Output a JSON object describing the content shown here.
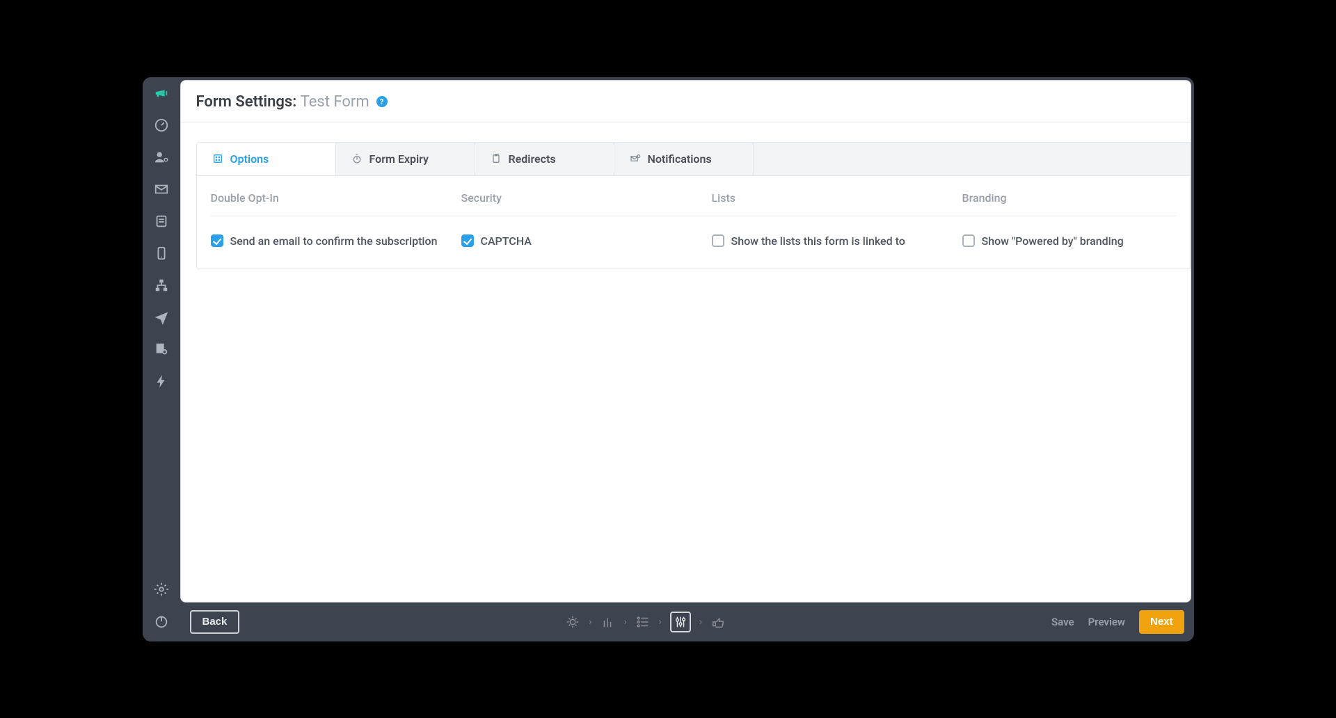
{
  "header": {
    "title_prefix": "Form Settings:",
    "form_name": "Test Form",
    "help_symbol": "?"
  },
  "tabs": [
    {
      "label": "Options",
      "active": true
    },
    {
      "label": "Form Expiry",
      "active": false
    },
    {
      "label": "Redirects",
      "active": false
    },
    {
      "label": "Notifications",
      "active": false
    }
  ],
  "columns": {
    "c1": "Double Opt-In",
    "c2": "Security",
    "c3": "Lists",
    "c4": "Branding"
  },
  "options": {
    "double_opt_in": {
      "label": "Send an email to confirm the subscription",
      "checked": true
    },
    "security": {
      "label": "CAPTCHA",
      "checked": true
    },
    "lists": {
      "label": "Show the lists this form is linked to",
      "checked": false
    },
    "branding": {
      "label": "Show \"Powered by\" branding",
      "checked": false
    }
  },
  "footer": {
    "back": "Back",
    "save": "Save",
    "preview": "Preview",
    "next": "Next"
  }
}
